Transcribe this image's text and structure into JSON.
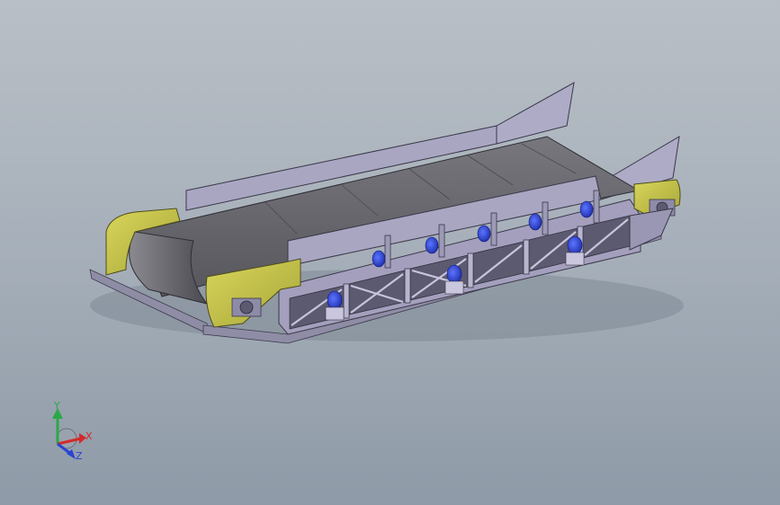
{
  "viewport": {
    "background_top": "#b9bfc6",
    "background_bottom": "#8e9aa7"
  },
  "model": {
    "frame_color": "#a39fbd",
    "belt_color": "#6a6a70",
    "end_guard_color": "#c6c44f",
    "idler_motor_color": "#2a3fd6"
  },
  "triad": {
    "x_label": "X",
    "y_label": "Y",
    "z_label": "Z",
    "x_color": "#d42a2a",
    "y_color": "#2aa84a",
    "z_color": "#2a44d4"
  }
}
